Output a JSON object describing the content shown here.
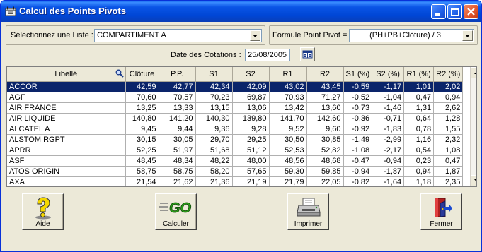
{
  "window": {
    "title": "Calcul des Points Pivots"
  },
  "liste": {
    "label": "Sélectionnez une Liste :",
    "value": "COMPARTIMENT A"
  },
  "formule": {
    "label": "Formule Point Pivot =",
    "value": "(PH+PB+Clôture) / 3"
  },
  "date": {
    "label": "Date des Cotations :",
    "value": "25/08/2005"
  },
  "table": {
    "columns": [
      "Libellé",
      "Clôture",
      "P.P.",
      "S1",
      "S2",
      "R1",
      "R2",
      "S1 (%)",
      "S2 (%)",
      "R1 (%)",
      "R2 (%)"
    ],
    "rows": [
      [
        "ACCOR",
        "42,59",
        "42,77",
        "42,34",
        "42,09",
        "43,02",
        "43,45",
        "-0,59",
        "-1,17",
        "1,01",
        "2,02"
      ],
      [
        "AGF",
        "70,60",
        "70,57",
        "70,23",
        "69,87",
        "70,93",
        "71,27",
        "-0,52",
        "-1,04",
        "0,47",
        "0,94"
      ],
      [
        "AIR FRANCE",
        "13,25",
        "13,33",
        "13,15",
        "13,06",
        "13,42",
        "13,60",
        "-0,73",
        "-1,46",
        "1,31",
        "2,62"
      ],
      [
        "AIR LIQUIDE",
        "140,80",
        "141,20",
        "140,30",
        "139,80",
        "141,70",
        "142,60",
        "-0,36",
        "-0,71",
        "0,64",
        "1,28"
      ],
      [
        "ALCATEL A",
        "9,45",
        "9,44",
        "9,36",
        "9,28",
        "9,52",
        "9,60",
        "-0,92",
        "-1,83",
        "0,78",
        "1,55"
      ],
      [
        "ALSTOM RGPT",
        "30,15",
        "30,05",
        "29,70",
        "29,25",
        "30,50",
        "30,85",
        "-1,49",
        "-2,99",
        "1,16",
        "2,32"
      ],
      [
        "APRR",
        "52,25",
        "51,97",
        "51,68",
        "51,12",
        "52,53",
        "52,82",
        "-1,08",
        "-2,17",
        "0,54",
        "1,08"
      ],
      [
        "ASF",
        "48,45",
        "48,34",
        "48,22",
        "48,00",
        "48,56",
        "48,68",
        "-0,47",
        "-0,94",
        "0,23",
        "0,47"
      ],
      [
        "ATOS ORIGIN",
        "58,75",
        "58,75",
        "58,20",
        "57,65",
        "59,30",
        "59,85",
        "-0,94",
        "-1,87",
        "0,94",
        "1,87"
      ],
      [
        "AXA",
        "21,54",
        "21,62",
        "21,36",
        "21,19",
        "21,79",
        "22,05",
        "-0,82",
        "-1,64",
        "1,18",
        "2,35"
      ]
    ],
    "selected_row": 0
  },
  "buttons": {
    "aide": "Aide",
    "calculer": "Calculer",
    "imprimer": "Imprimer",
    "fermer": "Fermer",
    "go_text": "GO"
  },
  "colors": {
    "selection": "#0a246a",
    "titlebar": "#0046d5",
    "face": "#ece9d8"
  }
}
